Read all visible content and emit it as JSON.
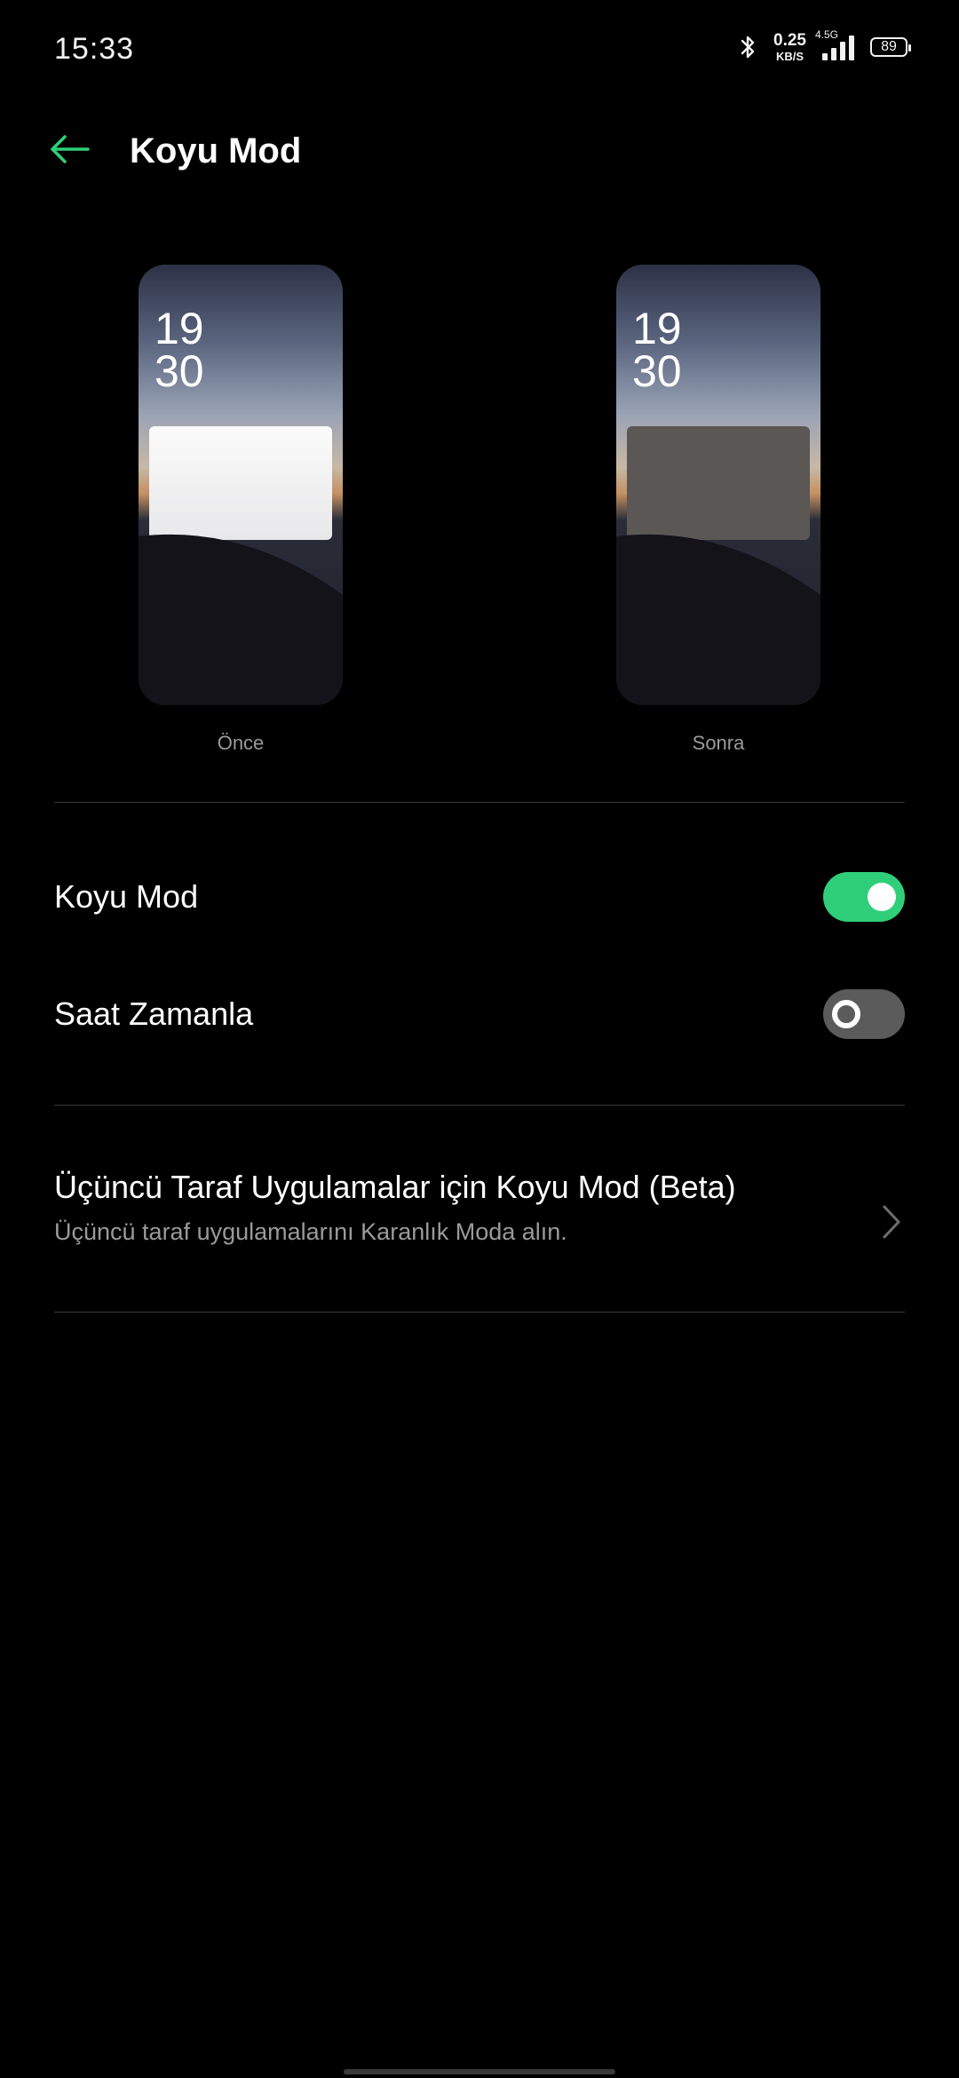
{
  "status_bar": {
    "time": "15:33",
    "net_speed_value": "0.25",
    "net_speed_unit": "KB/S",
    "signal_label": "4.5G",
    "battery": "89"
  },
  "header": {
    "title": "Koyu Mod",
    "back_icon": "arrow-left-icon"
  },
  "previews": {
    "before": {
      "clock_hour": "19",
      "clock_minute": "30",
      "caption": "Önce"
    },
    "after": {
      "clock_hour": "19",
      "clock_minute": "30",
      "caption": "Sonra"
    }
  },
  "settings": {
    "dark_mode": {
      "label": "Koyu Mod",
      "enabled": true
    },
    "schedule": {
      "label": "Saat Zamanla",
      "enabled": false
    }
  },
  "third_party": {
    "title": "Üçüncü Taraf Uygulamalar için Koyu Mod (Beta)",
    "subtitle": "Üçüncü taraf uygulamalarını Karanlık Moda alın.",
    "icon": "chevron-right-icon"
  },
  "colors": {
    "accent": "#2fcf7a",
    "background": "#000000",
    "secondary_text": "#9a9a9a"
  }
}
